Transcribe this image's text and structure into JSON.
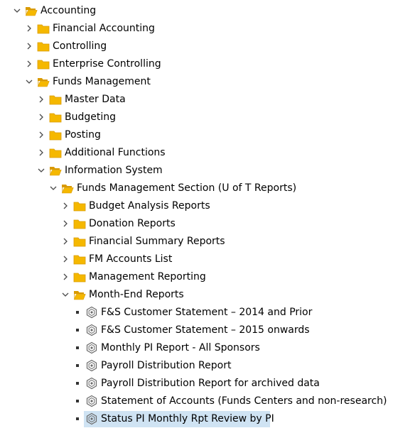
{
  "colors": {
    "folder": "#f5b800",
    "folder_dark": "#d99a00",
    "selection": "#cfe3f3",
    "report_icon": "#6b6b6b"
  },
  "tree": [
    {
      "label": "Accounting",
      "level": 0,
      "type": "folder",
      "expanded": true
    },
    {
      "label": "Financial Accounting",
      "level": 1,
      "type": "folder",
      "expanded": false
    },
    {
      "label": "Controlling",
      "level": 1,
      "type": "folder",
      "expanded": false
    },
    {
      "label": "Enterprise Controlling",
      "level": 1,
      "type": "folder",
      "expanded": false
    },
    {
      "label": "Funds Management",
      "level": 1,
      "type": "folder",
      "expanded": true
    },
    {
      "label": "Master Data",
      "level": 2,
      "type": "folder",
      "expanded": false
    },
    {
      "label": "Budgeting",
      "level": 2,
      "type": "folder",
      "expanded": false
    },
    {
      "label": "Posting",
      "level": 2,
      "type": "folder",
      "expanded": false
    },
    {
      "label": "Additional Functions",
      "level": 2,
      "type": "folder",
      "expanded": false
    },
    {
      "label": "Information System",
      "level": 2,
      "type": "folder",
      "expanded": true
    },
    {
      "label": "Funds Management Section (U of T Reports)",
      "level": 3,
      "type": "folder",
      "expanded": true
    },
    {
      "label": "Budget Analysis Reports",
      "level": 4,
      "type": "folder",
      "expanded": false
    },
    {
      "label": "Donation Reports",
      "level": 4,
      "type": "folder",
      "expanded": false
    },
    {
      "label": "Financial Summary Reports",
      "level": 4,
      "type": "folder",
      "expanded": false
    },
    {
      "label": "FM Accounts List",
      "level": 4,
      "type": "folder",
      "expanded": false
    },
    {
      "label": "Management Reporting",
      "level": 4,
      "type": "folder",
      "expanded": false
    },
    {
      "label": "Month-End Reports",
      "level": 4,
      "type": "folder",
      "expanded": true
    },
    {
      "label": "F&S Customer Statement – 2014 and Prior",
      "level": 5,
      "type": "report"
    },
    {
      "label": "F&S Customer Statement – 2015 onwards",
      "level": 5,
      "type": "report"
    },
    {
      "label": "Monthly PI Report - All Sponsors",
      "level": 5,
      "type": "report"
    },
    {
      "label": "Payroll Distribution Report",
      "level": 5,
      "type": "report"
    },
    {
      "label": "Payroll Distribution Report for archived data",
      "level": 5,
      "type": "report"
    },
    {
      "label": "Statement of Accounts (Funds Centers and non-research)",
      "level": 5,
      "type": "report"
    },
    {
      "label": "Status PI Monthly Rpt Review by PI",
      "level": 5,
      "type": "report",
      "selected": true
    }
  ]
}
